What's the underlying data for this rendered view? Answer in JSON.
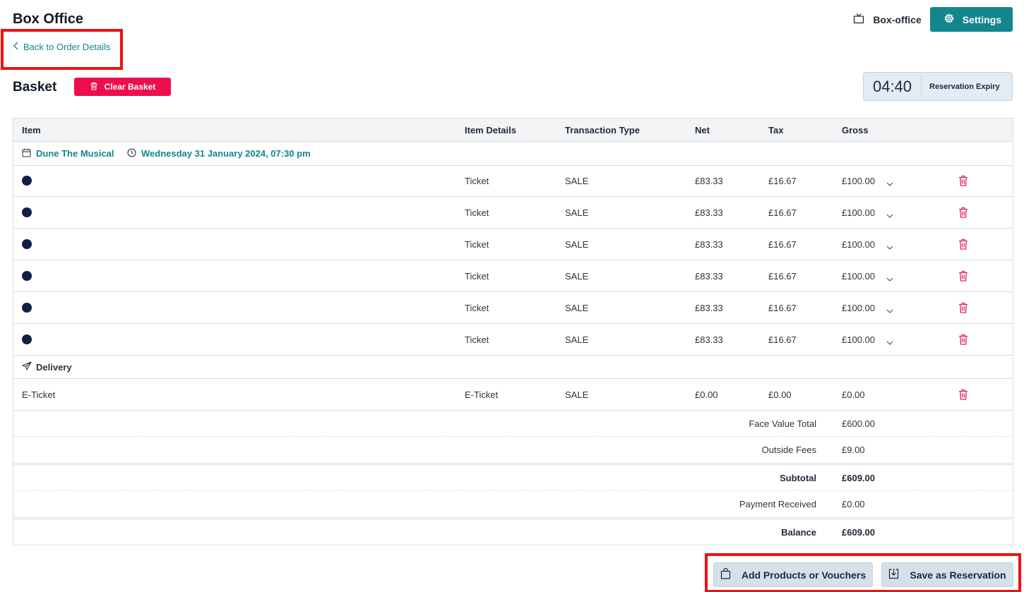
{
  "header": {
    "title": "Box Office",
    "boxoffice_label": "Box-office",
    "settings_label": "Settings"
  },
  "back_link": {
    "label": "Back to Order Details"
  },
  "basket": {
    "title": "Basket",
    "clear_label": "Clear Basket",
    "timer": {
      "value": "04:40",
      "label": "Reservation Expiry"
    }
  },
  "table": {
    "columns": [
      "Item",
      "Item Details",
      "Transaction Type",
      "Net",
      "Tax",
      "Gross"
    ],
    "event": {
      "name": "Dune The Musical",
      "datetime": "Wednesday 31 January 2024, 07:30 pm"
    },
    "tickets": [
      {
        "details": "Ticket",
        "type": "SALE",
        "net": "£83.33",
        "tax": "£16.67",
        "gross": "£100.00"
      },
      {
        "details": "Ticket",
        "type": "SALE",
        "net": "£83.33",
        "tax": "£16.67",
        "gross": "£100.00"
      },
      {
        "details": "Ticket",
        "type": "SALE",
        "net": "£83.33",
        "tax": "£16.67",
        "gross": "£100.00"
      },
      {
        "details": "Ticket",
        "type": "SALE",
        "net": "£83.33",
        "tax": "£16.67",
        "gross": "£100.00"
      },
      {
        "details": "Ticket",
        "type": "SALE",
        "net": "£83.33",
        "tax": "£16.67",
        "gross": "£100.00"
      },
      {
        "details": "Ticket",
        "type": "SALE",
        "net": "£83.33",
        "tax": "£16.67",
        "gross": "£100.00"
      }
    ],
    "delivery": {
      "section_label": "Delivery",
      "item": "E-Ticket",
      "details": "E-Ticket",
      "type": "SALE",
      "net": "£0.00",
      "tax": "£0.00",
      "gross": "£0.00"
    },
    "totals": {
      "face_value_label": "Face Value Total",
      "face_value": "£600.00",
      "outside_fees_label": "Outside Fees",
      "outside_fees": "£9.00",
      "subtotal_label": "Subtotal",
      "subtotal": "£609.00",
      "payment_label": "Payment Received",
      "payment": "£0.00",
      "balance_label": "Balance",
      "balance": "£609.00"
    }
  },
  "actions": {
    "add_label": "Add Products or Vouchers",
    "save_label": "Save as Reservation"
  },
  "colors": {
    "accent": "#13868d",
    "danger": "#ee0e4e",
    "highlight": "#ee1111",
    "seat_dot": "#0f1f45"
  },
  "icons": [
    "tv-icon",
    "gear-icon",
    "chevron-left-icon",
    "trash-icon",
    "calendar-icon",
    "clock-icon",
    "chevron-down-icon",
    "paper-plane-icon",
    "shopping-bag-icon",
    "download-icon"
  ]
}
